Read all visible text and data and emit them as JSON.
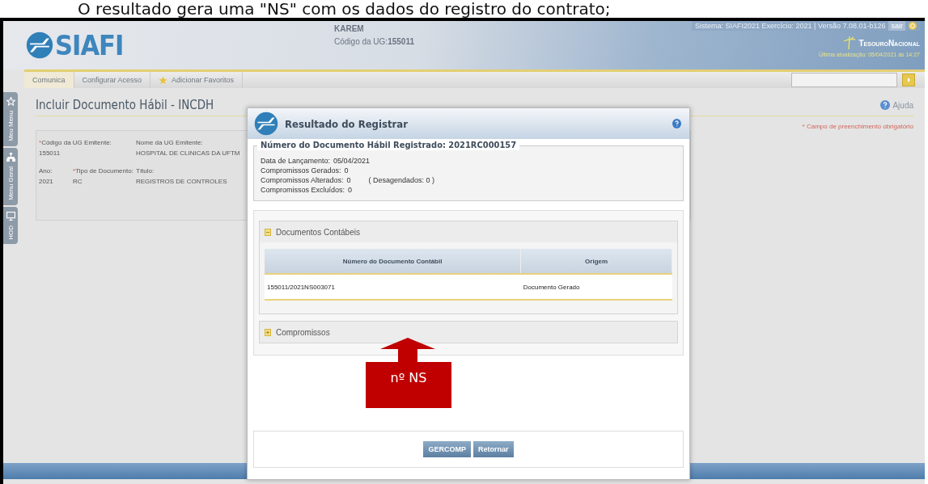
{
  "caption": "O resultado gera uma \"NS\" com os dados do registro do contrato;",
  "header": {
    "logo": "SIAFI",
    "user": "KAREM",
    "ug_label": "Código da UG:",
    "ug_code": "155011",
    "system_info": "Sistema: SIAFI2021 Exercício: 2021 | Versão 7.08.01-b126",
    "logout": "sair",
    "brand": "TesouroNacional",
    "last_update": "Última atualização: 05/04/2021 às 14:27"
  },
  "nav": {
    "tabs": [
      {
        "label": "Comunica",
        "selected": true,
        "kind": "plain"
      },
      {
        "label": "Configurar Acesso",
        "selected": false,
        "kind": "plain"
      },
      {
        "label": "Adicionar Favoritos",
        "selected": false,
        "kind": "favorite"
      }
    ]
  },
  "side_tabs": [
    {
      "label": "Meu Menu",
      "kind": "star"
    },
    {
      "label": "Menu Geral",
      "kind": "tree"
    },
    {
      "label": "HOD",
      "kind": "monitor"
    }
  ],
  "page": {
    "title": "Incluir Documento Hábil - INCDH",
    "help": "Ajuda",
    "required_note": "* Campo de preenchimento obrigatório",
    "rows": [
      [
        {
          "marker": "*",
          "label": "Código da UG Emitente:",
          "value": "155011"
        },
        "",
        {
          "label": "Nome da UG Emitente:",
          "value": "HOSPITAL DE CLINICAS DA UFTM"
        }
      ],
      [
        {
          "label": "Ano:",
          "value": "2021"
        },
        {
          "marker": "*",
          "label": "Tipo de Documento:",
          "value": "RC"
        },
        {
          "label": "Título:",
          "value": "REGISTROS DE CONTROLES"
        }
      ]
    ]
  },
  "modal": {
    "title": "Resultado do Registrar",
    "legend": "Número do Documento Hábil Registrado: 2021RC000157",
    "lines": [
      {
        "label": "Data de Lançamento:",
        "value": "05/04/2021"
      },
      {
        "label": "Compromissos Gerados:",
        "value": "0"
      },
      {
        "label": "Compromissos Alterados:",
        "value": "0",
        "extra": "( Desagendados: 0 )"
      },
      {
        "label": "Compromissos Excluídos:",
        "value": "0"
      }
    ],
    "sections": [
      {
        "title": "Documentos Contábeis",
        "expanded": true,
        "columns": [
          "Número do Documento Contábil",
          "Origem"
        ],
        "rows": [
          [
            "155011/2021NS003071",
            "Documento Gerado"
          ]
        ]
      },
      {
        "title": "Compromissos",
        "expanded": false
      }
    ],
    "buttons": [
      "GERCOMP",
      "Retornar"
    ]
  },
  "annotation": {
    "label": "nº NS"
  }
}
